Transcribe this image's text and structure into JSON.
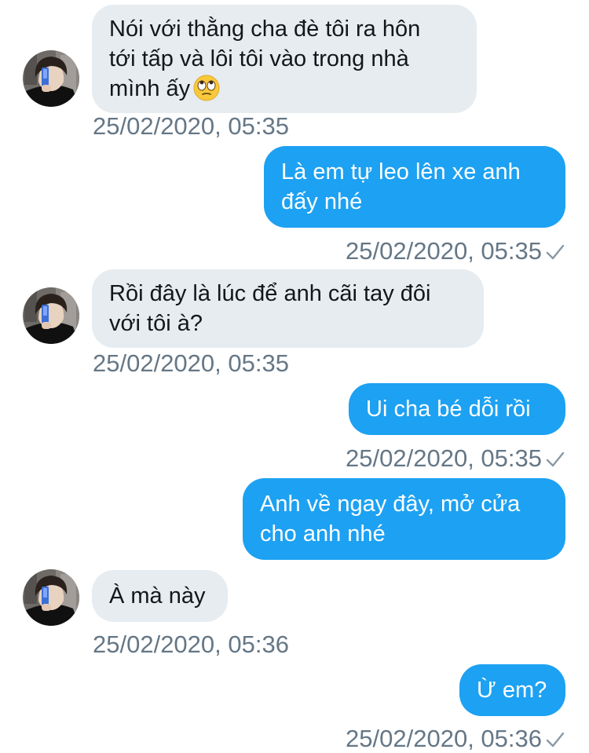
{
  "conversation": {
    "messages": [
      {
        "direction": "incoming",
        "text": "Nói với thằng cha đè tôi ra hôn\ntới tấp và lôi tôi vào trong nhà\nmình ấy",
        "emoji": "face-with-rolling-eyes",
        "time": "25/02/2020, 05:35"
      },
      {
        "direction": "outgoing",
        "text": "Là em tự leo lên xe anh\nđấy nhé",
        "time": "25/02/2020, 05:35",
        "status": "sent"
      },
      {
        "direction": "incoming",
        "text": "Rồi đây là lúc để anh cãi tay đôi\nvới tôi à?",
        "time": "25/02/2020, 05:35"
      },
      {
        "direction": "outgoing",
        "text": "Ui cha bé dỗi rồi",
        "time": "25/02/2020, 05:35",
        "status": "sent"
      },
      {
        "direction": "outgoing",
        "text": "Anh về ngay đây, mở cửa\ncho anh nhé"
      },
      {
        "direction": "incoming",
        "text": "À mà này",
        "time": "25/02/2020, 05:36"
      },
      {
        "direction": "outgoing",
        "text": "Ừ em?",
        "time": "25/02/2020, 05:36",
        "status": "sent"
      }
    ]
  },
  "colors": {
    "incoming_bubble": "#e6ecf0",
    "outgoing_bubble": "#1da1f2",
    "timestamp": "#657786"
  }
}
